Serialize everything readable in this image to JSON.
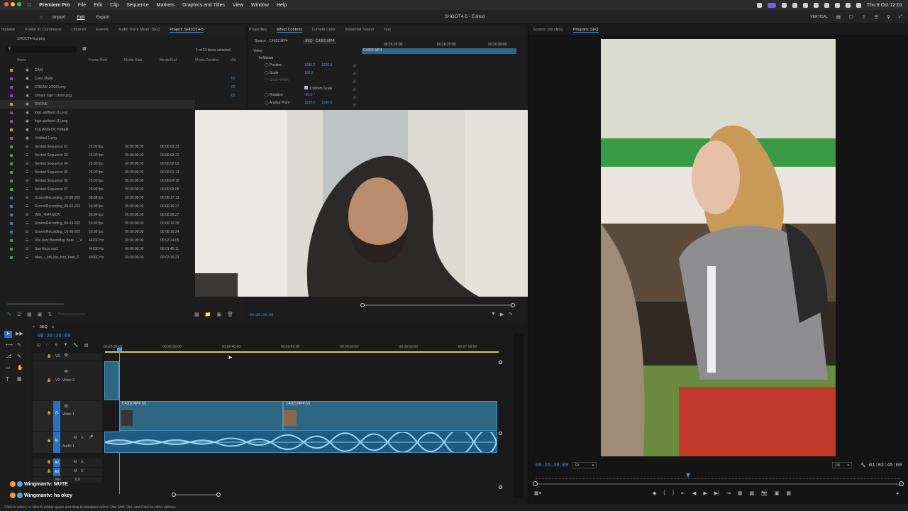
{
  "menubar": {
    "app": "Premiere Pro",
    "items": [
      "File",
      "Edit",
      "Clip",
      "Sequence",
      "Markers",
      "Graphics and Titles",
      "View",
      "Window",
      "Help"
    ],
    "datetime": "Thu 9 Oct 12:01"
  },
  "appbar": {
    "nav": [
      "Import",
      "Edit",
      "Export"
    ],
    "title": "SHOOT4-5 - Edited",
    "workspace": "VERTICAL"
  },
  "tabs_left": [
    "mplates",
    "Frame.io: Comments",
    "Libraries",
    "Events",
    "Audio Track Mixer: SEQ",
    "Project: SHOOT4-5"
  ],
  "tabs_mid": [
    "Properties",
    "Effect Controls",
    "Lumetri Color",
    "Essential Sound",
    "Text"
  ],
  "tabs_right": [
    "Source: (no clips)",
    "Program: SEQ"
  ],
  "project": {
    "file": "SHOOT4-5.prproj",
    "selected": "1 of 23 items selected",
    "columns": [
      "Name",
      "Frame Rate",
      "Media Start",
      "Media End",
      "Media Duration",
      "Vid"
    ],
    "items": [
      {
        "name": "CAM",
        "color": "#c9a227",
        "frame": "",
        "start": "",
        "end": "",
        "dur": ""
      },
      {
        "name": "Color Matte",
        "color": "#9b3fb5",
        "frame": "",
        "start": "",
        "end": "",
        "dur": "00"
      },
      {
        "name": "CREAM LOGO.png",
        "color": "#9b3fb5",
        "frame": "",
        "start": "",
        "end": "",
        "dur": "00"
      },
      {
        "name": "crfeam logo t shirts.png",
        "color": "#9b3fb5",
        "frame": "",
        "start": "",
        "end": "",
        "dur": "00"
      },
      {
        "name": "DRONE",
        "color": "#c9a227",
        "frame": "",
        "start": "",
        "end": "",
        "dur": ""
      },
      {
        "name": "logo ajsfhjesf (1).png",
        "color": "#9b3fb5",
        "frame": "",
        "start": "",
        "end": "",
        "dur": ""
      },
      {
        "name": "logo ajsfhjesf (1).png",
        "color": "#9b3fb5",
        "frame": "",
        "start": "",
        "end": "",
        "dur": ""
      },
      {
        "name": "TOLIANS-OCTOBER",
        "color": "#c9a227",
        "frame": "",
        "start": "",
        "end": "",
        "dur": ""
      },
      {
        "name": "Untitled 1.png",
        "color": "#9b3fb5",
        "frame": "",
        "start": "",
        "end": "",
        "dur": ""
      },
      {
        "name": "Nested Sequence 01",
        "color": "#3d9e5b",
        "frame": "25.00 fps",
        "start": "00:00:00:00",
        "end": "00:00:03:23",
        "dur": ""
      },
      {
        "name": "Nested Sequence 03",
        "color": "#3d9e5b",
        "frame": "25.00 fps",
        "start": "00:00:00:00",
        "end": "00:00:03:21",
        "dur": ""
      },
      {
        "name": "Nested Sequence 04",
        "color": "#3d9e5b",
        "frame": "25.00 fps",
        "start": "00:00:00:00",
        "end": "00:00:02:03",
        "dur": ""
      },
      {
        "name": "Nested Sequence 05",
        "color": "#3d9e5b",
        "frame": "25.00 fps",
        "start": "00:00:00:00",
        "end": "00:00:01:12",
        "dur": ""
      },
      {
        "name": "Nested Sequence 06",
        "color": "#3d9e5b",
        "frame": "25.00 fps",
        "start": "00:00:00:00",
        "end": "00:00:04:15",
        "dur": ""
      },
      {
        "name": "Nested Sequence 07",
        "color": "#3d9e5b",
        "frame": "25.00 fps",
        "start": "00:00:00:00",
        "end": "00:00:03:08",
        "dur": ""
      },
      {
        "name": "ScreenRecording_10-08-202",
        "color": "#2f7fb8",
        "frame": "58.88 fps",
        "start": "00:00:00:00",
        "end": "00:00:17:13",
        "dur": ""
      },
      {
        "name": "ScreenRecording_09-03-202",
        "color": "#2f7fb8",
        "frame": "59.99 fps",
        "start": "00:00:00:00",
        "end": "00:00:16:27",
        "dur": ""
      },
      {
        "name": "IMG_4844.MOV",
        "color": "#2f7fb8",
        "frame": "59.94 fps",
        "start": "00:00:00:00",
        "end": "00:00:36:27",
        "dur": ""
      },
      {
        "name": "ScreenRecording_09-03-202",
        "color": "#2f7fb8",
        "frame": "59.99 fps",
        "start": "00:00:00:00",
        "end": "00:00:16:39",
        "dur": ""
      },
      {
        "name": "ScreenRecording_10-08-202",
        "color": "#2f7fb8",
        "frame": "59.99 fps",
        "start": "00:00:00:00",
        "end": "00:00:16:24",
        "dur": ""
      },
      {
        "name": "90s Jazz BoomBap Beat - _\"A",
        "color": "#3d9e5b",
        "frame": "44100 Hz",
        "start": "00:00:00:00",
        "end": "00:02:24:05",
        "dur": ""
      },
      {
        "name": "Sun Rays.mp3",
        "color": "#3d9e5b",
        "frame": "44100 Hz",
        "start": "00:00:00:00",
        "end": "00:01:45:11",
        "dur": ""
      },
      {
        "name": "bliss_-_lofi_hip_hop_beat_F",
        "color": "#3d9e5b",
        "frame": "48000 Hz",
        "start": "00:00:00:00",
        "end": "00:02:19:23",
        "dur": ""
      }
    ]
  },
  "effect": {
    "source": "Source · C4302.MP4",
    "seq": "SEQ · C4302.MP4",
    "video": "Video",
    "motion": "Motion",
    "props": [
      {
        "label": "Position",
        "v1": "1080.0",
        "v2": "1920.0"
      },
      {
        "label": "Scale",
        "v1": "100.0",
        "v2": ""
      },
      {
        "label": "Scale Width",
        "v1": "",
        "v2": ""
      },
      {
        "label": "Uniform Scale",
        "v1": "",
        "v2": ""
      },
      {
        "label": "Rotation",
        "v1": "-90.0 °",
        "v2": ""
      },
      {
        "label": "Anchor Point",
        "v1": "1920.0",
        "v2": "1080.0"
      }
    ],
    "ruler": [
      "00:26:28:00",
      "00:26:29:00",
      "00:26:30:00"
    ],
    "clip": "C4302.MP4",
    "timecode": "00:26:30:09"
  },
  "timeline": {
    "seq": "SEQ",
    "timecode": "00:26:30:09",
    "ruler": [
      "00:26:30:00",
      "00:26:35:00",
      "00:26:40:00",
      "00:26:45:00",
      "00:26:50:00",
      "00:26:55:00",
      "00:27:00:00"
    ],
    "tracks": [
      {
        "id": "V3",
        "name": ""
      },
      {
        "id": "V2",
        "name": "Video 2"
      },
      {
        "id": "V1",
        "name": "Video 1"
      },
      {
        "id": "A1",
        "name": "Audio 1"
      },
      {
        "id": "A2",
        "name": ""
      },
      {
        "id": "A3",
        "name": ""
      }
    ],
    "clips": [
      "C4302.MP4 [V]",
      "C4303.MP4 [V]"
    ],
    "mix": "Mix",
    "mix_val": "0.0",
    "status": "Click to select, or click in empty space and drag to marquee select. Use Shift, Opt, and Cmd for other options."
  },
  "program": {
    "timecode": "00:26:30:09",
    "fit": "Fit",
    "quality": "1/8",
    "duration": "01:02:45:00"
  },
  "chat": [
    {
      "user": "Wingmantv:",
      "msg": "MUTE"
    },
    {
      "user": "Wingmantv:",
      "msg": "ha okey"
    }
  ],
  "colors": {
    "accent": "#3d9ae8",
    "clip": "#2e6784",
    "audio": "#1f5a82"
  }
}
